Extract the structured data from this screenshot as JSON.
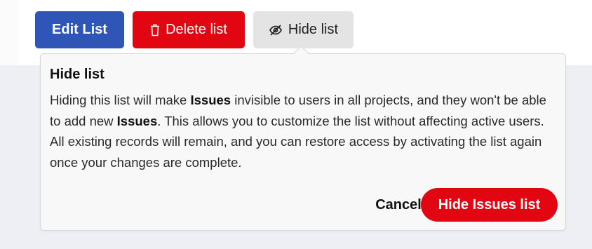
{
  "toolbar": {
    "edit_label": "Edit List",
    "delete_label": "Delete list",
    "hide_label": "Hide list"
  },
  "popover": {
    "title": "Hide list",
    "body": {
      "p1": "Hiding this list will make ",
      "b1": "Issues",
      "p2": " invisible to users in all projects, and they won't be able to add new ",
      "b2": "Issues",
      "p3": ". This allows you to customize the list without affecting active users. All existing records will remain, and you can restore access by activating the list again once your changes are complete."
    },
    "cancel_label": "Cancel",
    "confirm_label": "Hide Issues list"
  },
  "icons": {
    "delete": "trash-icon",
    "hide": "eye-slash-icon"
  },
  "colors": {
    "primary": "#2f55b6",
    "danger": "#e20613",
    "neutral": "#e4e4e4"
  }
}
